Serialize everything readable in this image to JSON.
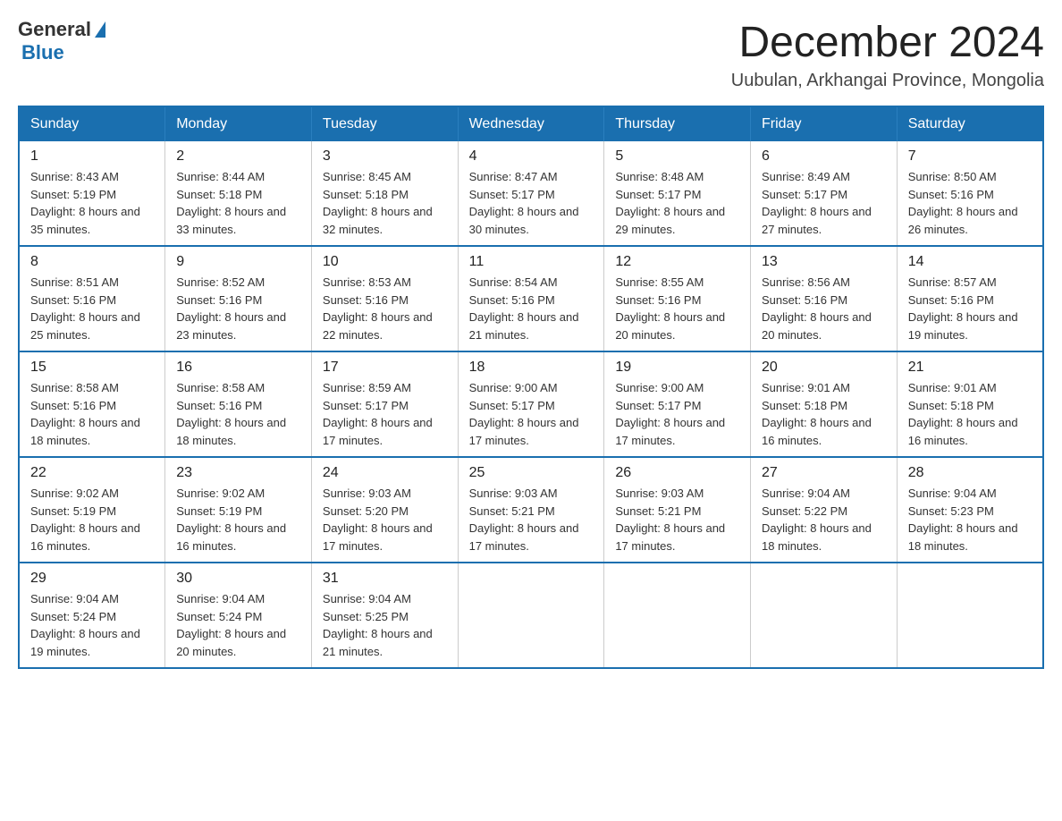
{
  "logo": {
    "general": "General",
    "blue": "Blue"
  },
  "title": "December 2024",
  "location": "Uubulan, Arkhangai Province, Mongolia",
  "days_of_week": [
    "Sunday",
    "Monday",
    "Tuesday",
    "Wednesday",
    "Thursday",
    "Friday",
    "Saturday"
  ],
  "weeks": [
    [
      {
        "day": "1",
        "sunrise": "8:43 AM",
        "sunset": "5:19 PM",
        "daylight": "8 hours and 35 minutes."
      },
      {
        "day": "2",
        "sunrise": "8:44 AM",
        "sunset": "5:18 PM",
        "daylight": "8 hours and 33 minutes."
      },
      {
        "day": "3",
        "sunrise": "8:45 AM",
        "sunset": "5:18 PM",
        "daylight": "8 hours and 32 minutes."
      },
      {
        "day": "4",
        "sunrise": "8:47 AM",
        "sunset": "5:17 PM",
        "daylight": "8 hours and 30 minutes."
      },
      {
        "day": "5",
        "sunrise": "8:48 AM",
        "sunset": "5:17 PM",
        "daylight": "8 hours and 29 minutes."
      },
      {
        "day": "6",
        "sunrise": "8:49 AM",
        "sunset": "5:17 PM",
        "daylight": "8 hours and 27 minutes."
      },
      {
        "day": "7",
        "sunrise": "8:50 AM",
        "sunset": "5:16 PM",
        "daylight": "8 hours and 26 minutes."
      }
    ],
    [
      {
        "day": "8",
        "sunrise": "8:51 AM",
        "sunset": "5:16 PM",
        "daylight": "8 hours and 25 minutes."
      },
      {
        "day": "9",
        "sunrise": "8:52 AM",
        "sunset": "5:16 PM",
        "daylight": "8 hours and 23 minutes."
      },
      {
        "day": "10",
        "sunrise": "8:53 AM",
        "sunset": "5:16 PM",
        "daylight": "8 hours and 22 minutes."
      },
      {
        "day": "11",
        "sunrise": "8:54 AM",
        "sunset": "5:16 PM",
        "daylight": "8 hours and 21 minutes."
      },
      {
        "day": "12",
        "sunrise": "8:55 AM",
        "sunset": "5:16 PM",
        "daylight": "8 hours and 20 minutes."
      },
      {
        "day": "13",
        "sunrise": "8:56 AM",
        "sunset": "5:16 PM",
        "daylight": "8 hours and 20 minutes."
      },
      {
        "day": "14",
        "sunrise": "8:57 AM",
        "sunset": "5:16 PM",
        "daylight": "8 hours and 19 minutes."
      }
    ],
    [
      {
        "day": "15",
        "sunrise": "8:58 AM",
        "sunset": "5:16 PM",
        "daylight": "8 hours and 18 minutes."
      },
      {
        "day": "16",
        "sunrise": "8:58 AM",
        "sunset": "5:16 PM",
        "daylight": "8 hours and 18 minutes."
      },
      {
        "day": "17",
        "sunrise": "8:59 AM",
        "sunset": "5:17 PM",
        "daylight": "8 hours and 17 minutes."
      },
      {
        "day": "18",
        "sunrise": "9:00 AM",
        "sunset": "5:17 PM",
        "daylight": "8 hours and 17 minutes."
      },
      {
        "day": "19",
        "sunrise": "9:00 AM",
        "sunset": "5:17 PM",
        "daylight": "8 hours and 17 minutes."
      },
      {
        "day": "20",
        "sunrise": "9:01 AM",
        "sunset": "5:18 PM",
        "daylight": "8 hours and 16 minutes."
      },
      {
        "day": "21",
        "sunrise": "9:01 AM",
        "sunset": "5:18 PM",
        "daylight": "8 hours and 16 minutes."
      }
    ],
    [
      {
        "day": "22",
        "sunrise": "9:02 AM",
        "sunset": "5:19 PM",
        "daylight": "8 hours and 16 minutes."
      },
      {
        "day": "23",
        "sunrise": "9:02 AM",
        "sunset": "5:19 PM",
        "daylight": "8 hours and 16 minutes."
      },
      {
        "day": "24",
        "sunrise": "9:03 AM",
        "sunset": "5:20 PM",
        "daylight": "8 hours and 17 minutes."
      },
      {
        "day": "25",
        "sunrise": "9:03 AM",
        "sunset": "5:21 PM",
        "daylight": "8 hours and 17 minutes."
      },
      {
        "day": "26",
        "sunrise": "9:03 AM",
        "sunset": "5:21 PM",
        "daylight": "8 hours and 17 minutes."
      },
      {
        "day": "27",
        "sunrise": "9:04 AM",
        "sunset": "5:22 PM",
        "daylight": "8 hours and 18 minutes."
      },
      {
        "day": "28",
        "sunrise": "9:04 AM",
        "sunset": "5:23 PM",
        "daylight": "8 hours and 18 minutes."
      }
    ],
    [
      {
        "day": "29",
        "sunrise": "9:04 AM",
        "sunset": "5:24 PM",
        "daylight": "8 hours and 19 minutes."
      },
      {
        "day": "30",
        "sunrise": "9:04 AM",
        "sunset": "5:24 PM",
        "daylight": "8 hours and 20 minutes."
      },
      {
        "day": "31",
        "sunrise": "9:04 AM",
        "sunset": "5:25 PM",
        "daylight": "8 hours and 21 minutes."
      },
      null,
      null,
      null,
      null
    ]
  ]
}
